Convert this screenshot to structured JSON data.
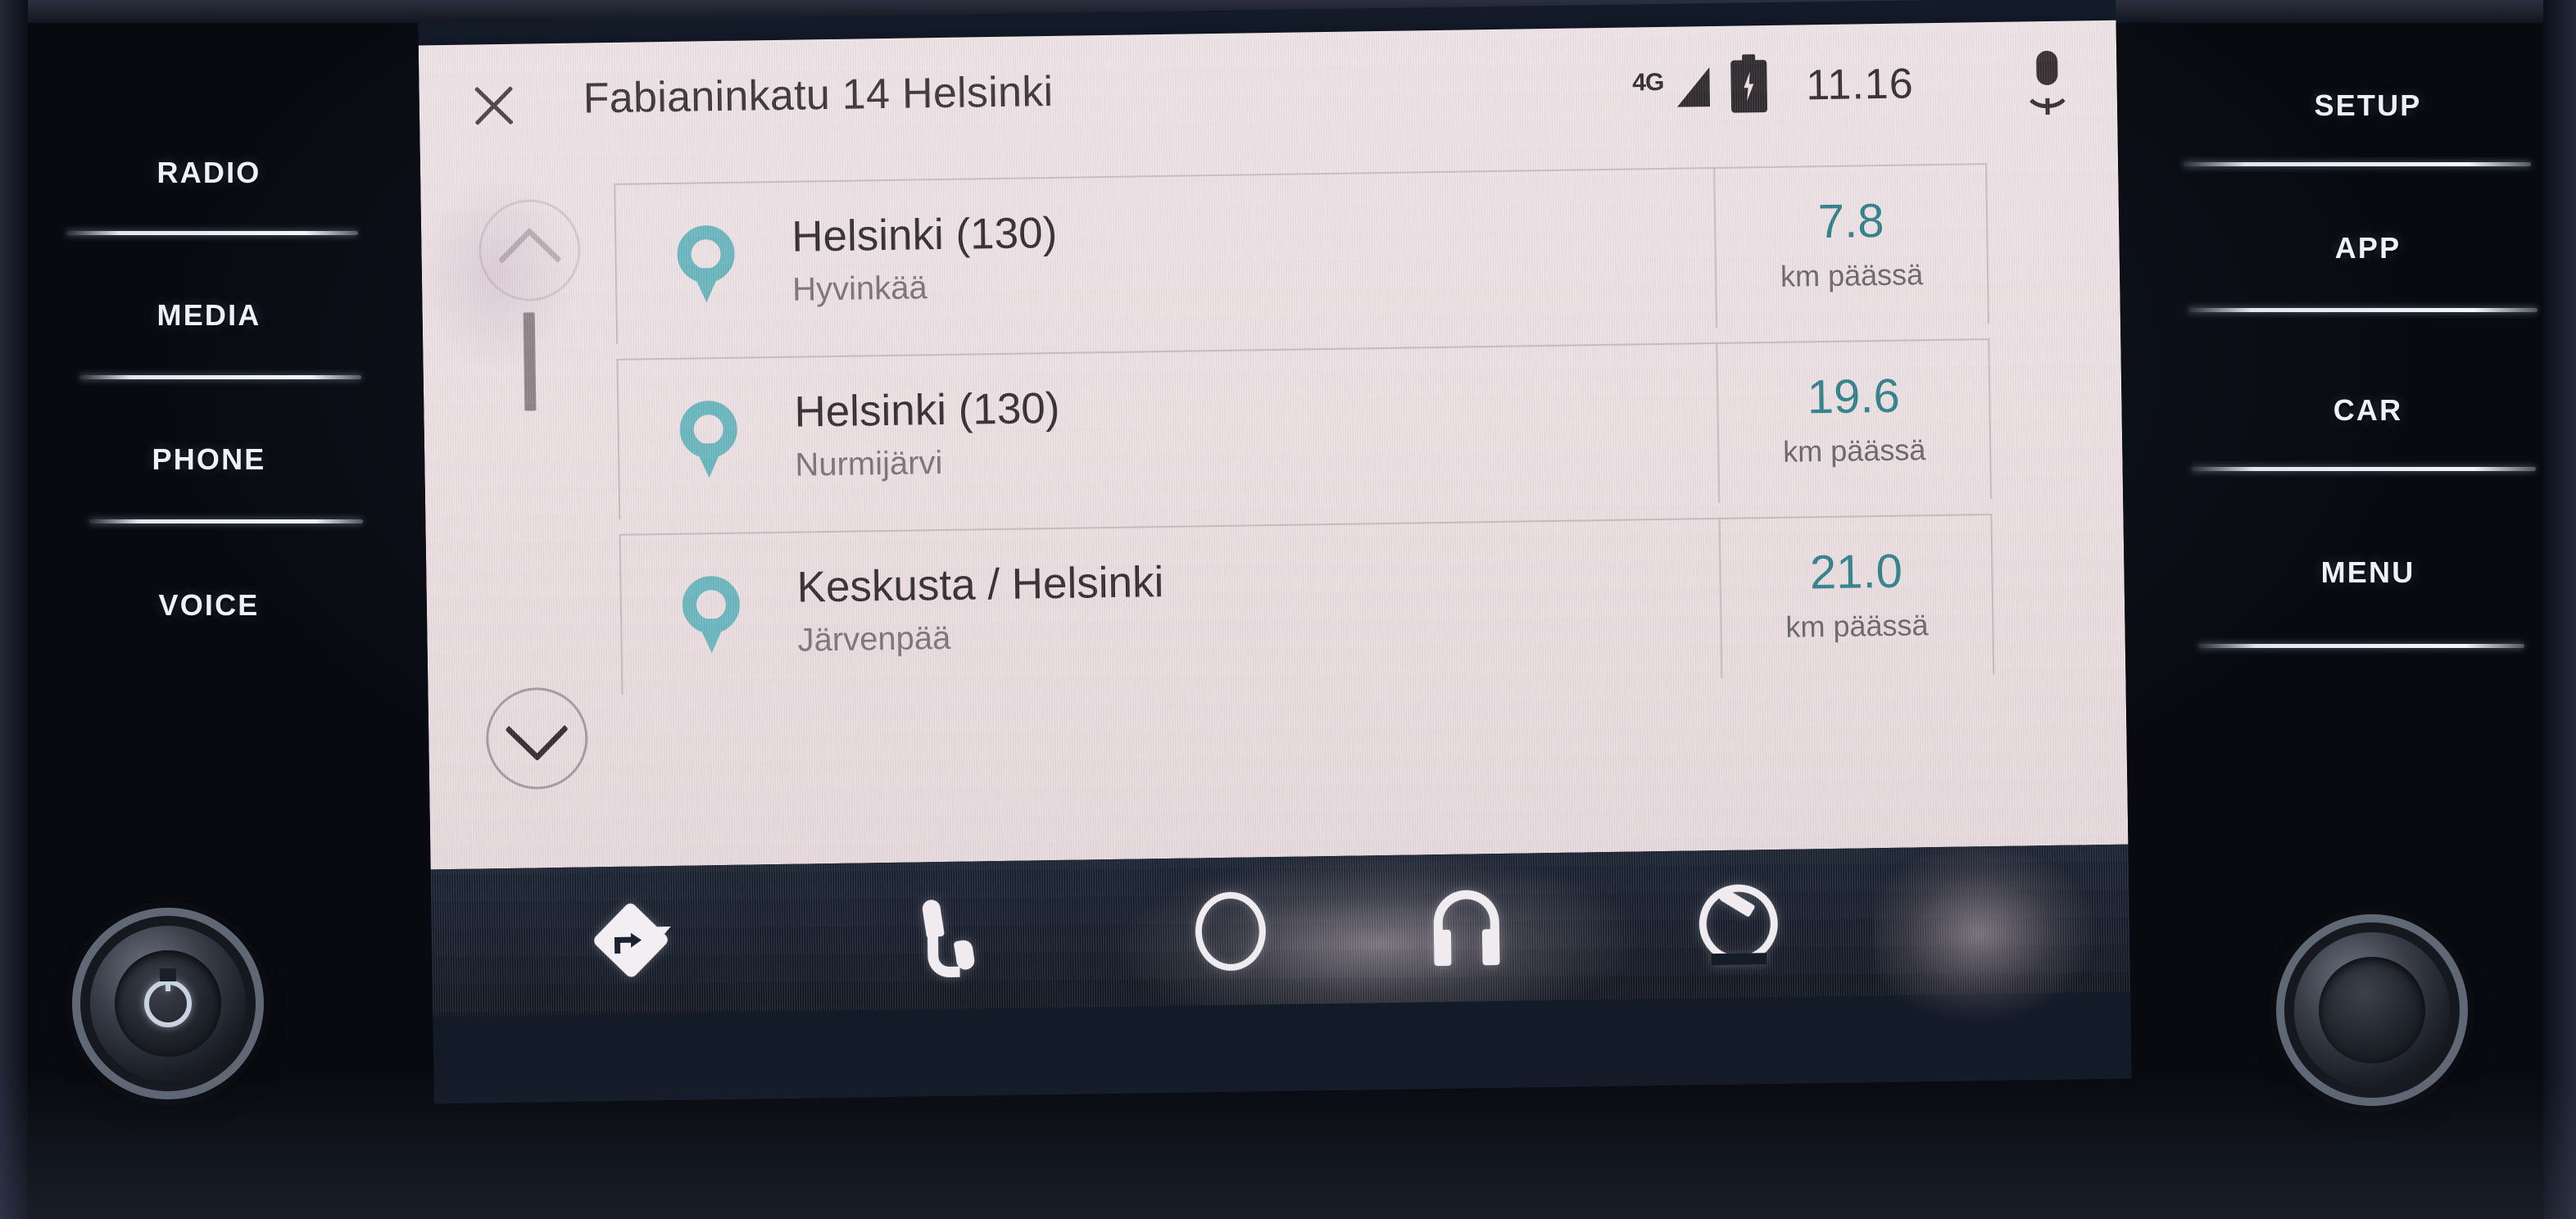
{
  "hard_keys": {
    "left": [
      "RADIO",
      "MEDIA",
      "PHONE",
      "VOICE"
    ],
    "right": [
      "SETUP",
      "APP",
      "CAR",
      "MENU"
    ]
  },
  "panel": {
    "close_label": "×",
    "title": "Fabianinkatu 14 Helsinki",
    "status": {
      "network": "4G",
      "signal_icon": "signal-triangle-icon",
      "battery_icon": "battery-charging-icon",
      "time": "11.16",
      "mic_icon": "microphone-icon"
    },
    "scroll": {
      "up_icon": "chevron-up-icon",
      "down_icon": "chevron-down-icon",
      "thumb": "scrollbar-thumb"
    },
    "results": [
      {
        "pin_icon": "map-pin-icon",
        "name": "Helsinki (130)",
        "locality": "Hyvinkää",
        "distance": "7.8",
        "distance_unit": "km päässä"
      },
      {
        "pin_icon": "map-pin-icon",
        "name": "Helsinki (130)",
        "locality": "Nurmijärvi",
        "distance": "19.6",
        "distance_unit": "km päässä"
      },
      {
        "pin_icon": "map-pin-icon",
        "name": "Keskusta / Helsinki",
        "locality": "Järvenpää",
        "distance": "21.0",
        "distance_unit": "km päässä"
      }
    ]
  },
  "bottom_nav": [
    {
      "icon": "navigation-diamond-icon",
      "label": ""
    },
    {
      "icon": "phone-handset-icon",
      "label": ""
    },
    {
      "icon": "home-circle-icon",
      "label": ""
    },
    {
      "icon": "headphones-icon",
      "label": ""
    },
    {
      "icon": "gauge-icon",
      "label": ""
    }
  ],
  "colors": {
    "accent_teal": "#2d7f89",
    "pin_teal": "#69b6be",
    "panel_bg": "#ece0e3",
    "navbar_bg": "#131a27",
    "text_primary": "#322b2f",
    "text_secondary": "#7b7277"
  }
}
